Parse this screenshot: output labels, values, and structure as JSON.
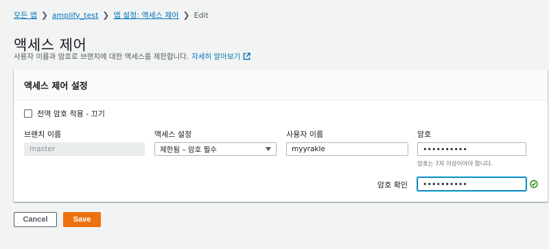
{
  "breadcrumb": {
    "items": [
      {
        "label": "모든 앱"
      },
      {
        "label": "amplify_test"
      },
      {
        "label": "앱 설정: 액세스 제어"
      }
    ],
    "current": "Edit"
  },
  "page": {
    "title": "액세스 제어",
    "description": "사용자 이름과 암호로 브랜치에 대한 액세스를 제한합니다.",
    "learn_more": "자세히 알아보기"
  },
  "panel": {
    "title": "액세스 제어 설정",
    "global_password_label": "전역 암호 적용 - 끄기",
    "global_password_checked": false
  },
  "columns": {
    "branch": "브랜치 이름",
    "access": "액세스 설정",
    "username": "사용자 이름",
    "password": "암호"
  },
  "row": {
    "branch_value": "master",
    "access_value": "제한됨 – 암호 필수",
    "username_value": "myyrakle",
    "password_value": "••••••••••",
    "password_hint": "암호는 7자 이상이어야 합니다.",
    "confirm_label": "암호 확인",
    "confirm_value": "••••••••••"
  },
  "icons": {
    "breadcrumb_separator": "chevron-right-icon",
    "learn_more": "external-link-icon",
    "dropdown": "caret-down-icon",
    "confirm_status": "check-circle-icon"
  },
  "colors": {
    "link": "#0073bb",
    "primary_button": "#ec7211",
    "success": "#1d8102",
    "focus": "#00a1c9"
  },
  "actions": {
    "cancel": "Cancel",
    "save": "Save"
  }
}
